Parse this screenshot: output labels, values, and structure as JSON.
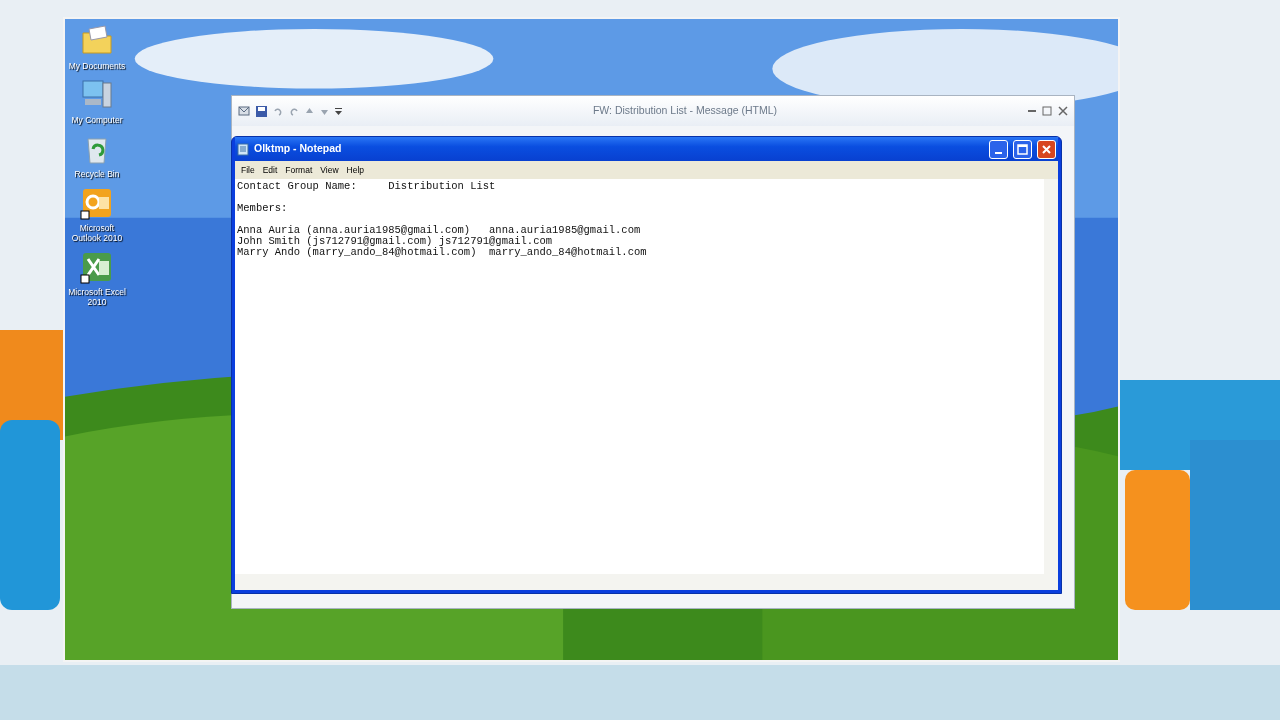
{
  "desktop_icons": [
    {
      "label": "My Documents",
      "kind": "folder"
    },
    {
      "label": "My Computer",
      "kind": "computer"
    },
    {
      "label": "Recycle Bin",
      "kind": "bin"
    },
    {
      "label": "Microsoft Outlook 2010",
      "kind": "outlook"
    },
    {
      "label": "Microsoft Excel 2010",
      "kind": "excel"
    }
  ],
  "outlook_window": {
    "title": "FW: Distribution List  -  Message (HTML)"
  },
  "notepad": {
    "title": "Olktmp - Notepad",
    "menu": [
      "File",
      "Edit",
      "Format",
      "View",
      "Help"
    ],
    "sections": [
      [
        "Contact Group Name:     Distribution List"
      ],
      [
        "Members:"
      ],
      [
        "Anna Auria (anna.auria1985@gmail.com)   anna.auria1985@gmail.com",
        "John Smith (js712791@gmail.com) js712791@gmail.com",
        "Marry Ando (marry_ando_84@hotmail.com)  marry_ando_84@hotmail.com"
      ]
    ]
  }
}
